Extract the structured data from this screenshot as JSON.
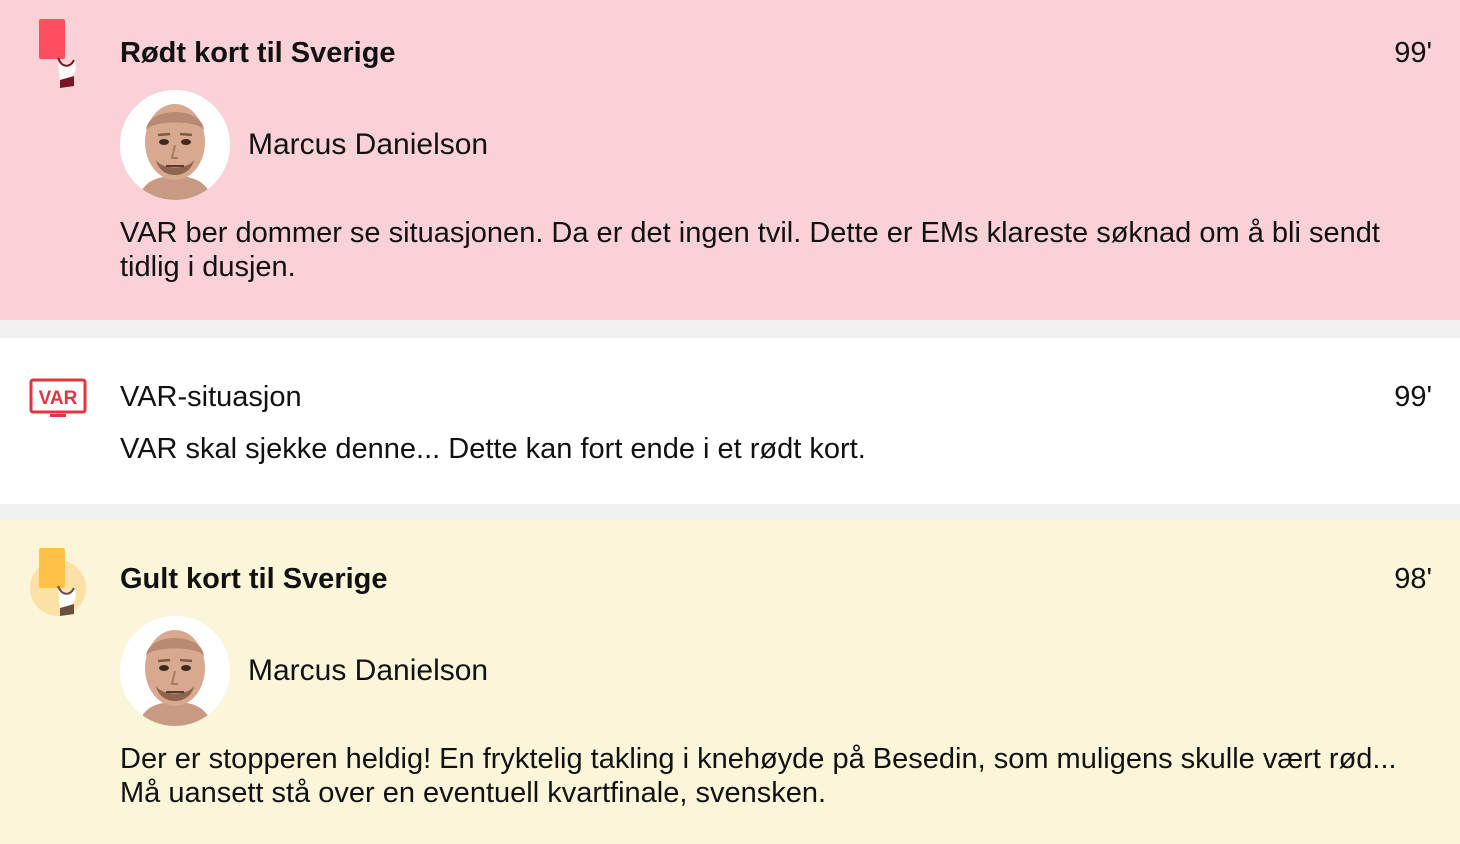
{
  "events": [
    {
      "type": "red-card",
      "title": "Rødt kort til Sverige",
      "minute": "99'",
      "player": "Marcus Danielson",
      "text": "VAR ber dommer se situasjonen. Da er det ingen tvil. Dette er EMs klareste søknad om å bli sendt tidlig i dusjen."
    },
    {
      "type": "var",
      "icon_label": "VAR",
      "title": "VAR-situasjon",
      "minute": "99'",
      "text": "VAR skal sjekke denne... Dette kan fort ende i et rødt kort."
    },
    {
      "type": "yellow-card",
      "title": "Gult kort til Sverige",
      "minute": "98'",
      "player": "Marcus Danielson",
      "text": "Der er stopperen heldig! En fryktelig takling i knehøyde på Besedin, som muligens skulle vært rød... Må uansett stå over en eventuell kvartfinale, svensken."
    }
  ],
  "colors": {
    "red_card": "#ff4f5e",
    "red_bg": "#f9d1d7",
    "yellow_card": "#ffc247",
    "yellow_bg": "#fbf5da",
    "var_red": "#e3343f"
  },
  "icons": [
    "red-card-icon",
    "var-icon",
    "yellow-card-icon"
  ]
}
